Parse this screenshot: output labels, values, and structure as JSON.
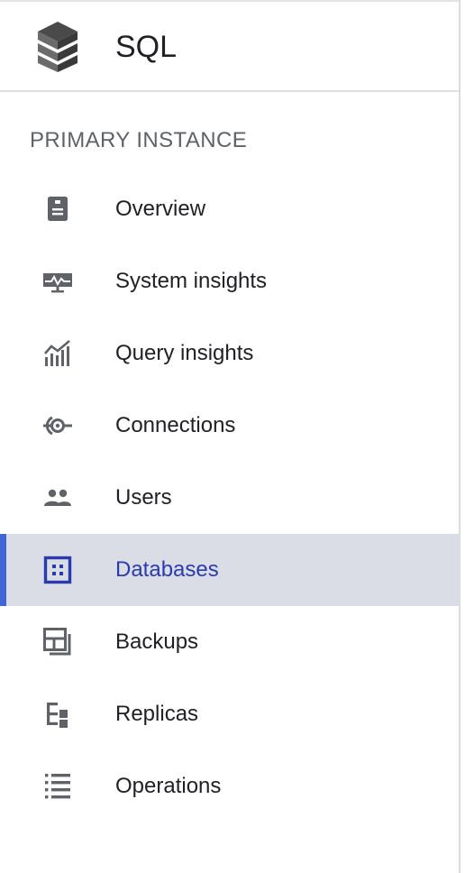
{
  "header": {
    "title": "SQL",
    "logo_icon": "sql-stack-icon"
  },
  "section": {
    "label": "PRIMARY INSTANCE"
  },
  "colors": {
    "active_background": "#dadde6",
    "active_indicator": "#4167d6",
    "active_text": "#2a3bb0",
    "icon_default": "#5f6368",
    "section_label": "#5f6368"
  },
  "nav": {
    "active_index": 5,
    "items": [
      {
        "label": "Overview",
        "icon": "overview-icon"
      },
      {
        "label": "System insights",
        "icon": "monitor-icon"
      },
      {
        "label": "Query insights",
        "icon": "chart-icon"
      },
      {
        "label": "Connections",
        "icon": "connection-icon"
      },
      {
        "label": "Users",
        "icon": "users-icon"
      },
      {
        "label": "Databases",
        "icon": "database-grid-icon"
      },
      {
        "label": "Backups",
        "icon": "backup-icon"
      },
      {
        "label": "Replicas",
        "icon": "replica-icon"
      },
      {
        "label": "Operations",
        "icon": "list-icon"
      }
    ]
  }
}
